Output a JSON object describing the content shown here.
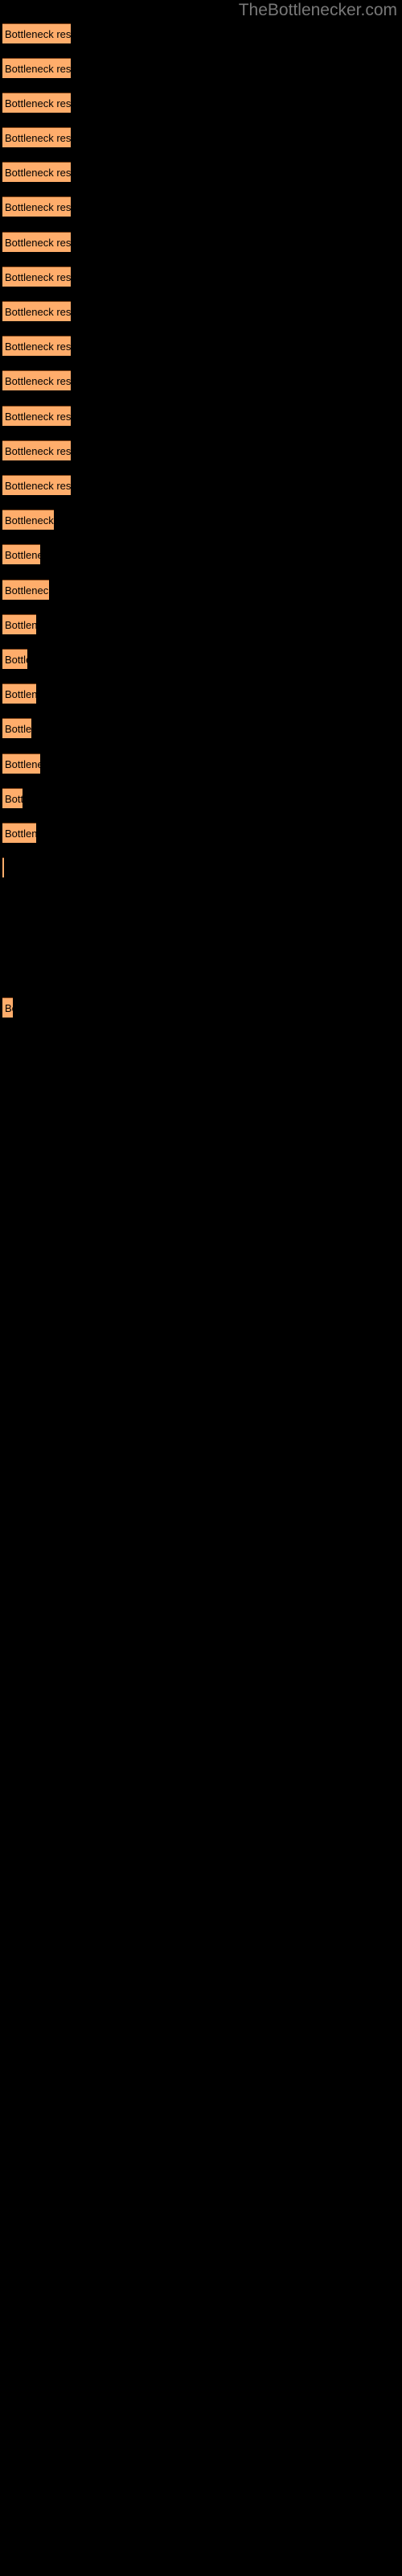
{
  "header": {
    "site_title": "TheBottlenecker.com",
    "title_color": "#787878"
  },
  "colors": {
    "background": "#000000",
    "bar_fill": "#ffad6b",
    "bar_border_top": "#7a3f14",
    "bar_label_text": "#000000"
  },
  "chart_data": {
    "type": "bar",
    "orientation": "horizontal",
    "title": "TheBottlenecker.com",
    "subtitle": "",
    "xlabel": "",
    "ylabel": "",
    "grid": false,
    "legend": "none",
    "bar_label_text": "Bottleneck result",
    "xlim": [
      0,
      500
    ],
    "note": "Each bar is labelled 'Bottleneck result'; the label is clipped to the bar width so longer bars show more of the text.",
    "categories": [
      "Bottleneck result",
      "Bottleneck result",
      "Bottleneck result",
      "Bottleneck result",
      "Bottleneck result",
      "Bottleneck result",
      "Bottleneck result",
      "Bottleneck result",
      "Bottleneck result",
      "Bottleneck result",
      "Bottleneck result",
      "Bottleneck result",
      "Bottleneck result",
      "Bottleneck result",
      "Bottleneck result",
      "Bottleneck result",
      "Bottleneck result",
      "Bottleneck result",
      "Bottleneck result",
      "Bottleneck result",
      "Bottleneck result",
      "Bottleneck result",
      "Bottleneck result",
      "Bottleneck result",
      "Bottleneck result",
      "Bottleneck result",
      "Bottleneck result"
    ],
    "values": [
      85,
      85,
      85,
      85,
      85,
      85,
      85,
      85,
      85,
      85,
      85,
      85,
      85,
      85,
      64,
      47,
      58,
      42,
      31,
      42,
      36,
      47,
      25,
      42,
      2,
      13
    ],
    "bars": [
      {
        "index": 1,
        "y": 29,
        "width": 85,
        "label": "Bottleneck result"
      },
      {
        "index": 2,
        "y": 72,
        "width": 85,
        "label": "Bottleneck result"
      },
      {
        "index": 3,
        "y": 115,
        "width": 85,
        "label": "Bottleneck result"
      },
      {
        "index": 4,
        "y": 158,
        "width": 85,
        "label": "Bottleneck result"
      },
      {
        "index": 5,
        "y": 201,
        "width": 85,
        "label": "Bottleneck result"
      },
      {
        "index": 6,
        "y": 244,
        "width": 85,
        "label": "Bottleneck result"
      },
      {
        "index": 7,
        "y": 288,
        "width": 85,
        "label": "Bottleneck result"
      },
      {
        "index": 8,
        "y": 331,
        "width": 85,
        "label": "Bottleneck result"
      },
      {
        "index": 9,
        "y": 374,
        "width": 85,
        "label": "Bottleneck result"
      },
      {
        "index": 10,
        "y": 417,
        "width": 85,
        "label": "Bottleneck result"
      },
      {
        "index": 11,
        "y": 460,
        "width": 85,
        "label": "Bottleneck result"
      },
      {
        "index": 12,
        "y": 504,
        "width": 85,
        "label": "Bottleneck result"
      },
      {
        "index": 13,
        "y": 547,
        "width": 85,
        "label": "Bottleneck result"
      },
      {
        "index": 14,
        "y": 590,
        "width": 85,
        "label": "Bottleneck result"
      },
      {
        "index": 15,
        "y": 633,
        "width": 64,
        "label": "Bottleneck result"
      },
      {
        "index": 16,
        "y": 676,
        "width": 47,
        "label": "Bottleneck result"
      },
      {
        "index": 17,
        "y": 720,
        "width": 58,
        "label": "Bottleneck result"
      },
      {
        "index": 18,
        "y": 763,
        "width": 42,
        "label": "Bottleneck result"
      },
      {
        "index": 19,
        "y": 806,
        "width": 31,
        "label": "Bottleneck result"
      },
      {
        "index": 20,
        "y": 849,
        "width": 42,
        "label": "Bottleneck result"
      },
      {
        "index": 21,
        "y": 892,
        "width": 36,
        "label": "Bottleneck result"
      },
      {
        "index": 22,
        "y": 936,
        "width": 47,
        "label": "Bottleneck result"
      },
      {
        "index": 23,
        "y": 979,
        "width": 25,
        "label": "Bottleneck result"
      },
      {
        "index": 24,
        "y": 1022,
        "width": 42,
        "label": "Bottleneck result"
      },
      {
        "index": 25,
        "y": 1065,
        "width": 2,
        "label": "Bottleneck result"
      },
      {
        "index": 26,
        "y": 1239,
        "width": 13,
        "label": "Bottleneck result"
      }
    ]
  }
}
